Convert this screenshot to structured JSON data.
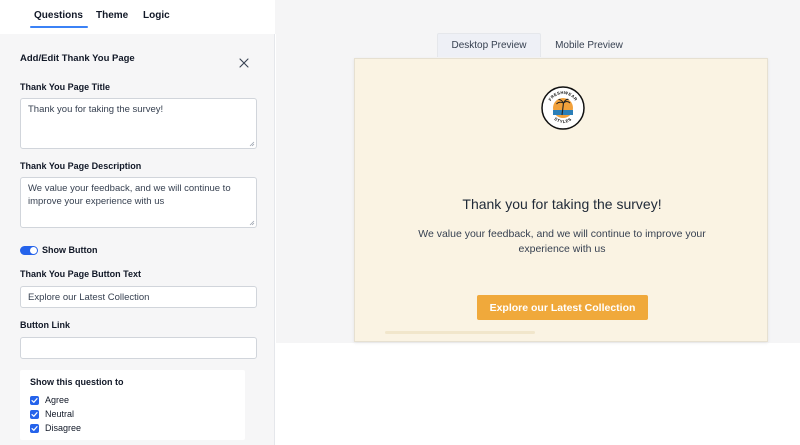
{
  "tabs": [
    {
      "label": "Questions",
      "active": true
    },
    {
      "label": "Theme",
      "active": false
    },
    {
      "label": "Logic",
      "active": false
    }
  ],
  "panel": {
    "title": "Add/Edit Thank You Page",
    "title_label": "Thank You Page Title",
    "title_value": "Thank you for taking the survey!",
    "description_label": "Thank You Page Description",
    "description_value": "We value your feedback, and we will continue to improve your experience with us",
    "show_button_label": "Show Button",
    "show_button_on": true,
    "button_text_label": "Thank You Page Button Text",
    "button_text_value": "Explore our Latest Collection",
    "button_link_label": "Button Link",
    "button_link_value": "",
    "show_to": {
      "title": "Show this question to",
      "options": [
        {
          "label": "Agree",
          "checked": true
        },
        {
          "label": "Neutral",
          "checked": true
        },
        {
          "label": "Disagree",
          "checked": true
        }
      ]
    }
  },
  "preview": {
    "tabs": [
      {
        "label": "Desktop Preview",
        "active": true
      },
      {
        "label": "Mobile Preview",
        "active": false
      }
    ],
    "logo_text_top": "FRESHWEAR",
    "logo_text_bottom": "STYLES",
    "title": "Thank you for taking the survey!",
    "description": "We value your feedback, and we will continue to improve your experience with us",
    "button_label": "Explore our Latest Collection",
    "colors": {
      "background": "#faf3e3",
      "button": "#f0a93b",
      "accent": "#2563eb"
    }
  },
  "icons": {
    "close": "close-icon",
    "checkbox": "check-icon",
    "logo": "palm-logo-icon"
  }
}
